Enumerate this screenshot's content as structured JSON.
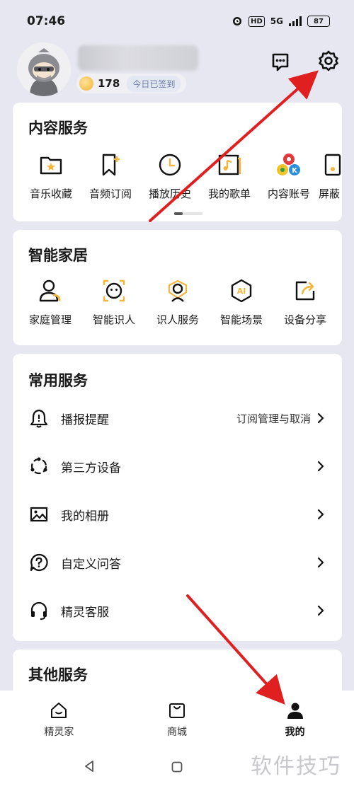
{
  "status": {
    "time": "07:46",
    "network": "5G",
    "battery": "87"
  },
  "profile": {
    "coins": "178",
    "checkin_label": "今日已签到"
  },
  "content_services": {
    "title": "内容服务",
    "items": [
      {
        "label": "音乐收藏",
        "icon": "star-folder-icon"
      },
      {
        "label": "音频订阅",
        "icon": "bookmark-plus-icon"
      },
      {
        "label": "播放历史",
        "icon": "clock-icon"
      },
      {
        "label": "我的歌单",
        "icon": "playlist-icon"
      },
      {
        "label": "内容账号",
        "icon": "accounts-icon"
      },
      {
        "label": "屏蔽",
        "icon": "block-icon"
      }
    ]
  },
  "smart_home": {
    "title": "智能家居",
    "items": [
      {
        "label": "家庭管理",
        "icon": "person-icon"
      },
      {
        "label": "智能识人",
        "icon": "face-scan-icon"
      },
      {
        "label": "识人服务",
        "icon": "face-service-icon"
      },
      {
        "label": "智能场景",
        "icon": "ai-hexagon-icon"
      },
      {
        "label": "设备分享",
        "icon": "share-icon"
      }
    ]
  },
  "common_services": {
    "title": "常用服务",
    "items": [
      {
        "label": "播报提醒",
        "sub": "订阅管理与取消",
        "icon": "bell-icon"
      },
      {
        "label": "第三方设备",
        "sub": "",
        "icon": "devices-icon"
      },
      {
        "label": "我的相册",
        "sub": "",
        "icon": "photo-icon"
      },
      {
        "label": "自定义问答",
        "sub": "",
        "icon": "question-icon"
      },
      {
        "label": "精灵客服",
        "sub": "",
        "icon": "headset-icon"
      }
    ]
  },
  "other_services": {
    "title": "其他服务"
  },
  "tabs": [
    {
      "label": "精灵家",
      "icon": "home-icon",
      "active": false
    },
    {
      "label": "商城",
      "icon": "shop-icon",
      "active": false
    },
    {
      "label": "我的",
      "icon": "profile-icon",
      "active": true
    }
  ],
  "watermark": "软件技巧",
  "colors": {
    "accent": "#f5b53d",
    "annotation_arrow": "#e02020",
    "background": "#e6e7f0"
  }
}
